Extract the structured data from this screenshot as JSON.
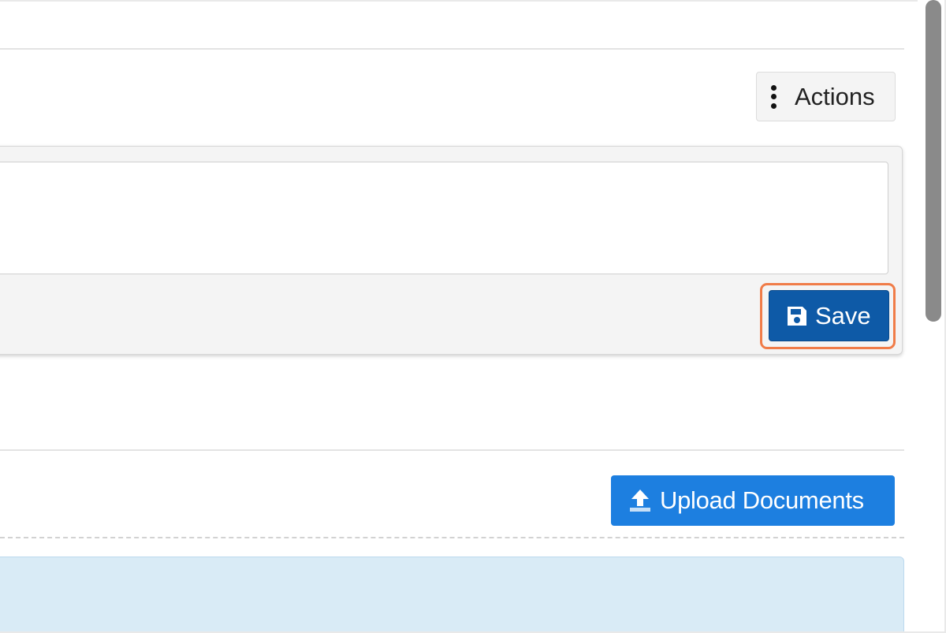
{
  "toolbar": {
    "actions_label": "Actions",
    "actions_icon": "more-vertical-icon"
  },
  "editor": {
    "text_value": "",
    "save_label": "Save",
    "save_icon": "floppy-disk-icon",
    "save_color": "#0e5aa7",
    "highlight_color": "#f07c48"
  },
  "documents": {
    "upload_label": "Upload Documents",
    "upload_icon": "upload-icon",
    "upload_color": "#1d7fe0",
    "info_box_color": "#d9ebf6"
  }
}
